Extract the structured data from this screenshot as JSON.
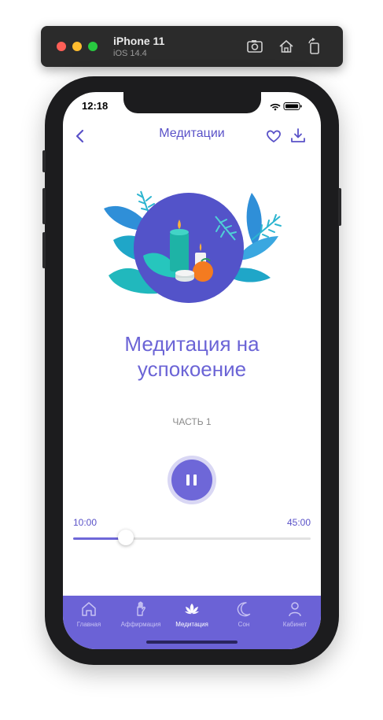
{
  "simulator": {
    "device": "iPhone 11",
    "os": "iOS 14.4"
  },
  "status_bar": {
    "time": "12:18"
  },
  "nav": {
    "title": "Медитации"
  },
  "meditation": {
    "title": "Медитация на успокоение",
    "part": "ЧАСТЬ 1"
  },
  "player": {
    "current_time": "10:00",
    "total_time": "45:00",
    "progress_fraction": 0.2222
  },
  "tabs": [
    {
      "label": "Главная",
      "icon": "home-icon",
      "active": false
    },
    {
      "label": "Аффирмация",
      "icon": "affirmation-hand-icon",
      "active": false
    },
    {
      "label": "Медитация",
      "icon": "lotus-icon",
      "active": true
    },
    {
      "label": "Сон",
      "icon": "moon-icon",
      "active": false
    },
    {
      "label": "Кабинет",
      "icon": "user-icon",
      "active": false
    }
  ],
  "colors": {
    "accent": "#6b62d6",
    "title": "#6b64d6"
  }
}
